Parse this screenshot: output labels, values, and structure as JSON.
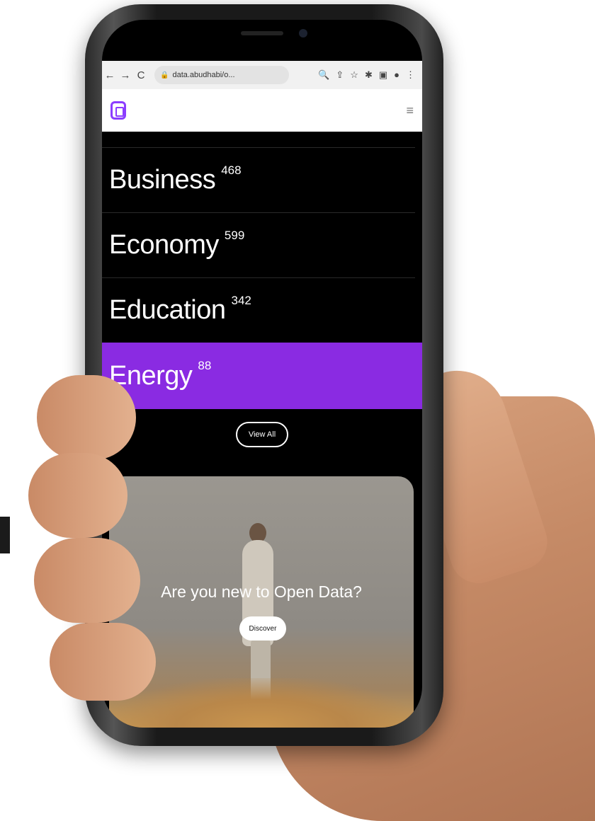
{
  "browser": {
    "url": "data.abudhabi/o...",
    "nav_back": "←",
    "nav_forward": "→",
    "nav_reload": "C",
    "lock_icon": "lock-icon",
    "icons": [
      "search-icon",
      "share-icon",
      "star-icon",
      "extensions-icon",
      "tab-icon",
      "profile-icon",
      "menu-icon"
    ]
  },
  "header": {
    "logo_icon": "logo-icon",
    "menu_icon": "hamburger-icon"
  },
  "categories": [
    {
      "name": "Business",
      "count": "468"
    },
    {
      "name": "Economy",
      "count": "599"
    },
    {
      "name": "Education",
      "count": "342"
    },
    {
      "name": "Energy",
      "count": "88"
    }
  ],
  "view_all_label": "View All",
  "promo": {
    "title": "Are you new to Open Data?",
    "button_label": "Discover"
  },
  "colors": {
    "accent": "#8a2be2",
    "background": "#000000"
  }
}
